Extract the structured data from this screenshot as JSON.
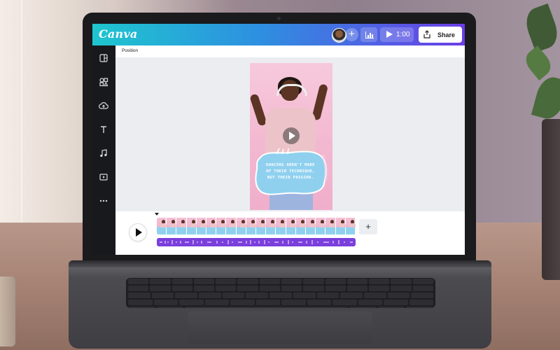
{
  "app": {
    "logo_text": "Canva",
    "brand_gradient": [
      "#1ec6cf",
      "#2e8fe0",
      "#6b3ee6"
    ]
  },
  "header": {
    "play_duration": "1:00",
    "share_label": "Share",
    "icons": [
      "user-avatar",
      "plus-icon",
      "bar-chart-icon",
      "play-icon",
      "share-upload-icon"
    ]
  },
  "sidebar": {
    "items": [
      {
        "icon": "layout-icon"
      },
      {
        "icon": "elements-icon"
      },
      {
        "icon": "upload-icon"
      },
      {
        "icon": "text-icon"
      },
      {
        "icon": "music-icon"
      },
      {
        "icon": "video-icon"
      },
      {
        "icon": "more-icon"
      }
    ]
  },
  "context_bar": {
    "position_label": "Position"
  },
  "design": {
    "quote_lines": [
      "DANCERS AREN'T MADE",
      "OF THEIR TECHNIQUE,",
      "BUT THEIR PASSION."
    ],
    "colors": {
      "background": "#f3b8d1",
      "blob": "#8fd0ef"
    }
  },
  "timeline": {
    "clip_frame_count": 20,
    "add_label": "+",
    "audio_color": "#7a3fdc"
  }
}
